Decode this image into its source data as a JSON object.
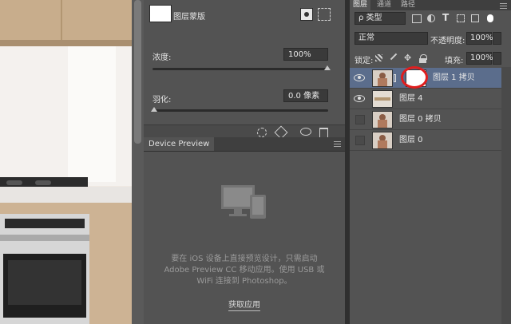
{
  "properties": {
    "mask_label": "图层蒙版",
    "density_label": "浓度:",
    "density_value": "100%",
    "feather_label": "羽化:",
    "feather_value": "0.0 像素"
  },
  "device_preview": {
    "tab_label": "Device Preview",
    "message": "要在 iOS 设备上直接预览设计，只需启动 Adobe Preview CC 移动应用。使用 USB 或 WiFi 连接到 Photoshop。",
    "link_label": "获取应用"
  },
  "layers_panel": {
    "tabs": [
      "图层",
      "通道",
      "路径"
    ],
    "filter_kind": "ρ 类型",
    "blend_mode": "正常",
    "opacity_label": "不透明度:",
    "opacity_value": "100%",
    "lock_label": "锁定:",
    "fill_label": "填充:",
    "fill_value": "100%",
    "layers": [
      {
        "name": "图层 1 拷贝",
        "visible": true,
        "selected": true
      },
      {
        "name": "图层 4",
        "visible": true,
        "selected": false
      },
      {
        "name": "图层 0 拷贝",
        "visible": false,
        "selected": false
      },
      {
        "name": "图层 0",
        "visible": false,
        "selected": false
      }
    ]
  },
  "colors": {
    "panel_bg": "#535353",
    "selected_row": "#5b6d8c",
    "highlight_circle": "#e01e1e"
  }
}
